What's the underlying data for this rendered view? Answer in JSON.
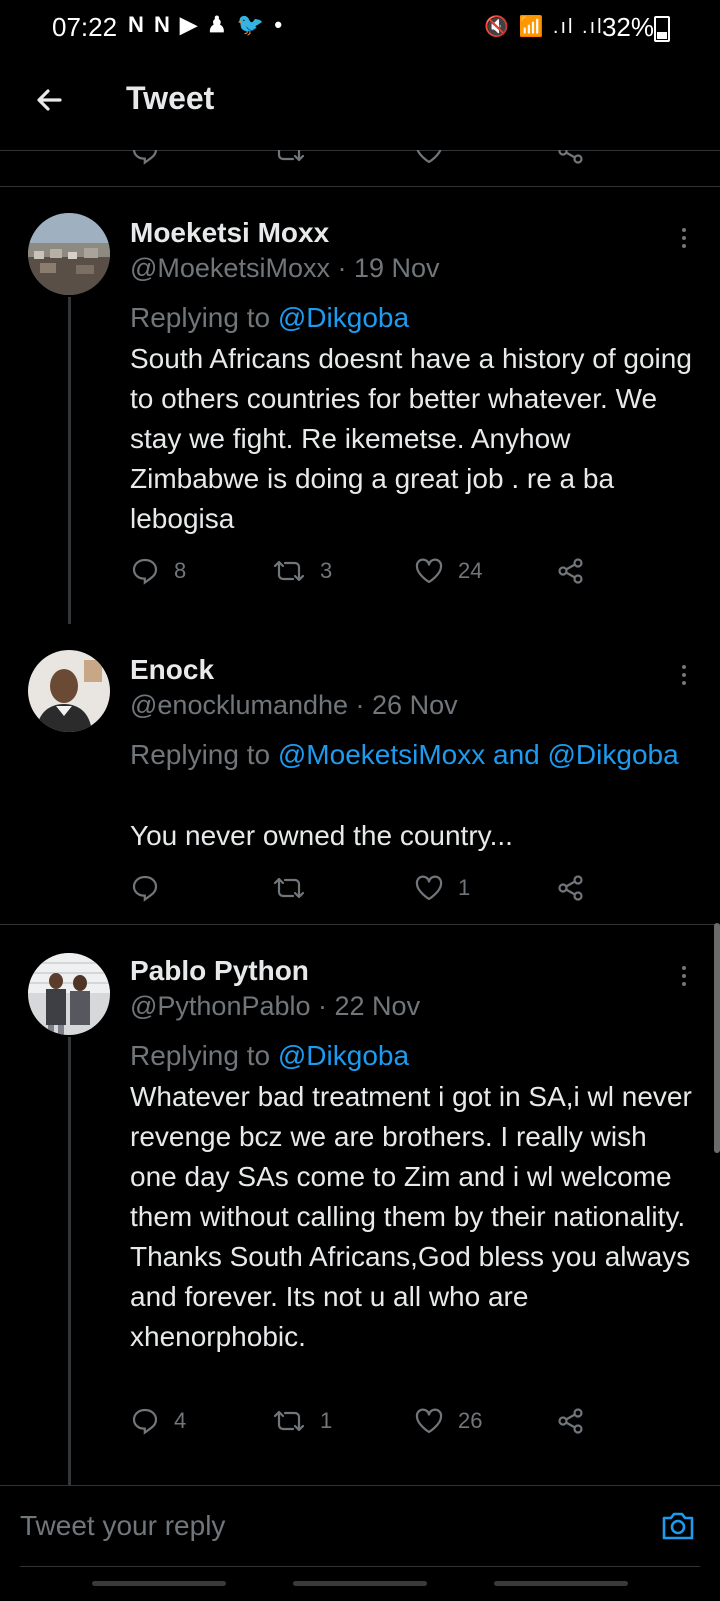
{
  "status_bar": {
    "time": "07:22",
    "notification_icons": "N N ▶ ♟ 🐦 •",
    "system_icons": "🔇 📶 .ıl .ıl",
    "battery": "32%"
  },
  "header": {
    "title": "Tweet"
  },
  "tweets": [
    {
      "name": "Moeketsi Moxx",
      "handle_date": "@MoeketsiMoxx · 19 Nov",
      "replying_prefix": "Replying to ",
      "replying_to": "@Dikgoba",
      "text": "South Africans doesnt have a history of going to others countries for better whatever. We stay we fight. Re ikemetse. Anyhow Zimbabwe is doing a great job . re a ba lebogisa",
      "replies": "8",
      "retweets": "3",
      "likes": "24"
    },
    {
      "name": "Enock",
      "handle_date": "@enocklumandhe · 26 Nov",
      "replying_prefix": "Replying to ",
      "replying_to": "@MoeketsiMoxx and @Dikgoba",
      "text": "You never owned the country...",
      "replies": "",
      "retweets": "",
      "likes": "1"
    },
    {
      "name": "Pablo Python",
      "handle_date": "@PythonPablo · 22 Nov",
      "replying_prefix": "Replying to ",
      "replying_to": "@Dikgoba",
      "text": "Whatever bad treatment i got in SA,i wl never revenge bcz we are brothers. I really wish one day SAs come to Zim and i wl welcome them without calling them by their nationality. Thanks South Africans,God bless you always and forever. Its not u all who are xhenorphobic.",
      "replies": "4",
      "retweets": "1",
      "likes": "26"
    }
  ],
  "composer": {
    "placeholder": "Tweet your reply"
  },
  "colors": {
    "background": "#000000",
    "text": "#e7e9ea",
    "muted": "#71767b",
    "accent": "#1d9bf0",
    "divider": "#2f3336"
  }
}
